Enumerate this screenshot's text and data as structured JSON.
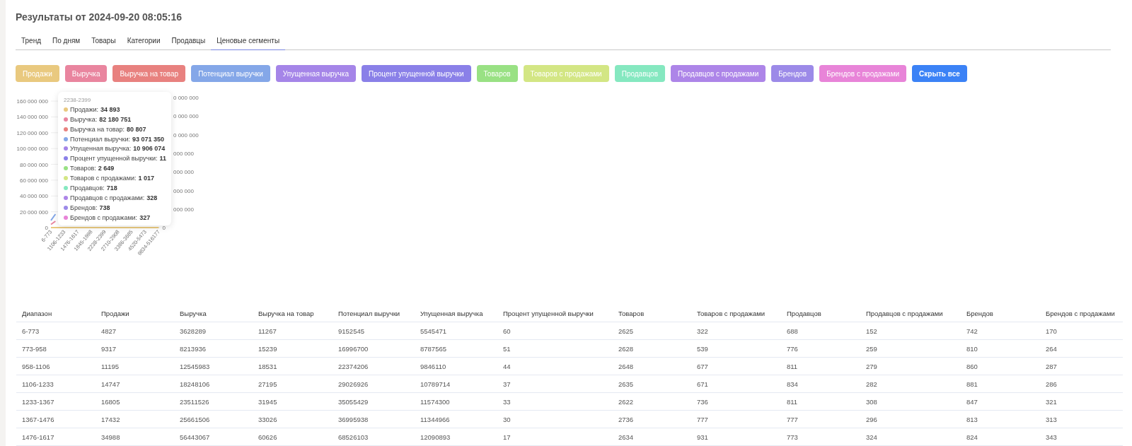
{
  "title": "Результаты от 2024-09-20 08:05:16",
  "tabs": [
    {
      "label": "Тренд",
      "selected": false
    },
    {
      "label": "По дням",
      "selected": false
    },
    {
      "label": "Товары",
      "selected": false
    },
    {
      "label": "Категории",
      "selected": false
    },
    {
      "label": "Продавцы",
      "selected": false
    },
    {
      "label": "Ценовые сегменты",
      "selected": true
    }
  ],
  "series_buttons": [
    {
      "label": "Продажи",
      "kind": "series",
      "color": "#e9c97f"
    },
    {
      "label": "Выручка",
      "kind": "series",
      "color": "#e9859f"
    },
    {
      "label": "Выручка на товар",
      "kind": "series",
      "color": "#e8817f"
    },
    {
      "label": "Потенциал выручки",
      "kind": "series",
      "color": "#84a7e8"
    },
    {
      "label": "Упущенная выручка",
      "kind": "series",
      "color": "#a585e8"
    },
    {
      "label": "Процент упущенной выручки",
      "kind": "series",
      "color": "#8a80e8"
    },
    {
      "label": "Товаров",
      "kind": "series",
      "color": "#99e184"
    },
    {
      "label": "Товаров с продажами",
      "kind": "series",
      "color": "#d3e684"
    },
    {
      "label": "Продавцов",
      "kind": "series",
      "color": "#85e8c0"
    },
    {
      "label": "Продавцов с продажами",
      "kind": "series",
      "color": "#ad85e8"
    },
    {
      "label": "Брендов",
      "kind": "series",
      "color": "#9c8ae8"
    },
    {
      "label": "Брендов с продажами",
      "kind": "series",
      "color": "#e884d8"
    },
    {
      "label": "Скрыть все",
      "kind": "hide-all",
      "color": "#3b82f6"
    }
  ],
  "chart": {
    "chart_data": {
      "type": "line",
      "grid": true,
      "categories": [
        "6-773",
        null,
        null,
        "1106-1233",
        null,
        null,
        "1476-1617",
        null,
        null,
        "1845-1998",
        null,
        null,
        "2238-2399",
        null,
        null,
        "2710-2908",
        null,
        null,
        "3386-3685",
        null,
        null,
        "4520-5473",
        null,
        null,
        "9834-516177"
      ],
      "ylim": [
        0,
        160000000
      ],
      "yticks": [
        {
          "value": 0,
          "label": "0"
        },
        {
          "value": 20000000,
          "label": "20 000 000"
        },
        {
          "value": 40000000,
          "label": "40 000 000"
        },
        {
          "value": 60000000,
          "label": "60 000 000"
        },
        {
          "value": 80000000,
          "label": "80 000 000"
        },
        {
          "value": 100000000,
          "label": "100 000 000"
        },
        {
          "value": 120000000,
          "label": "120 000 000"
        },
        {
          "value": 140000000,
          "label": "140 000 000"
        },
        {
          "value": 160000000,
          "label": "160 000 000"
        }
      ],
      "series": [
        {
          "color": "#e9c97f",
          "values": [
            0,
            0,
            0,
            0,
            0,
            0,
            0,
            0,
            0,
            0,
            0,
            0,
            0,
            0,
            0,
            0,
            0,
            0,
            0,
            0,
            0,
            0,
            0,
            0,
            0
          ]
        },
        {
          "color": "#e9859f",
          "values": [
            4000000,
            8000000,
            null,
            null,
            null,
            null,
            null,
            null,
            null,
            null,
            null,
            null,
            null,
            null,
            null,
            null,
            null,
            null,
            null,
            null,
            null,
            null,
            null,
            null,
            null
          ]
        },
        {
          "color": "#84a7e8",
          "values": [
            9000000,
            17000000,
            null,
            null,
            null,
            null,
            null,
            null,
            null,
            null,
            null,
            null,
            null,
            null,
            null,
            null,
            null,
            null,
            null,
            null,
            null,
            null,
            null,
            null,
            null
          ]
        }
      ]
    },
    "right_axis_labels": [
      "0 000 000",
      "0 000 000",
      "0 000 000",
      "000 000",
      "000 000",
      "000 000",
      "000 000",
      "0"
    ],
    "tooltip": {
      "title": "2238-2399",
      "rows": [
        {
          "label": "Продажи:",
          "value": "34 893",
          "color": "#e9c97f"
        },
        {
          "label": "Выручка:",
          "value": "82 180 751",
          "color": "#e9859f"
        },
        {
          "label": "Выручка на товар:",
          "value": "80 807",
          "color": "#e8817f"
        },
        {
          "label": "Потенциал выручки:",
          "value": "93 071 350",
          "color": "#84a7e8"
        },
        {
          "label": "Упущенная выручка:",
          "value": "10 906 074",
          "color": "#a585e8"
        },
        {
          "label": "Процент упущенной выручки:",
          "value": "11",
          "color": "#8a80e8"
        },
        {
          "label": "Товаров:",
          "value": "2 649",
          "color": "#99e184"
        },
        {
          "label": "Товаров с продажами:",
          "value": "1 017",
          "color": "#d3e684"
        },
        {
          "label": "Продавцов:",
          "value": "718",
          "color": "#85e8c0"
        },
        {
          "label": "Продавцов с продажами:",
          "value": "328",
          "color": "#ad85e8"
        },
        {
          "label": "Брендов:",
          "value": "738",
          "color": "#9c8ae8"
        },
        {
          "label": "Брендов с продажами:",
          "value": "327",
          "color": "#e884d8"
        }
      ]
    }
  },
  "table": {
    "columns": [
      "Диапазон",
      "Продажи",
      "Выручка",
      "Выручка на товар",
      "Потенциал выручки",
      "Упущенная выручка",
      "Процент упущенной выручки",
      "Товаров",
      "Товаров с продажами",
      "Продавцов",
      "Продавцов с продажами",
      "Брендов",
      "Брендов с продажами"
    ],
    "rows": [
      [
        "6-773",
        "4827",
        "3628289",
        "11267",
        "9152545",
        "5545471",
        "60",
        "2625",
        "322",
        "688",
        "152",
        "742",
        "170"
      ],
      [
        "773-958",
        "9317",
        "8213936",
        "15239",
        "16996700",
        "8787565",
        "51",
        "2628",
        "539",
        "776",
        "259",
        "810",
        "264"
      ],
      [
        "958-1106",
        "11195",
        "12545983",
        "18531",
        "22374206",
        "9846110",
        "44",
        "2648",
        "677",
        "811",
        "279",
        "860",
        "287"
      ],
      [
        "1106-1233",
        "14747",
        "18248106",
        "27195",
        "29026926",
        "10789714",
        "37",
        "2635",
        "671",
        "834",
        "282",
        "881",
        "286"
      ],
      [
        "1233-1367",
        "16805",
        "23511526",
        "31945",
        "35055429",
        "11574300",
        "33",
        "2622",
        "736",
        "811",
        "308",
        "847",
        "321"
      ],
      [
        "1367-1476",
        "17432",
        "25661506",
        "33026",
        "36995938",
        "11344966",
        "30",
        "2736",
        "777",
        "777",
        "296",
        "813",
        "313"
      ],
      [
        "1476-1617",
        "34988",
        "56443067",
        "60626",
        "68526103",
        "12090893",
        "17",
        "2634",
        "931",
        "773",
        "324",
        "824",
        "343"
      ]
    ]
  }
}
